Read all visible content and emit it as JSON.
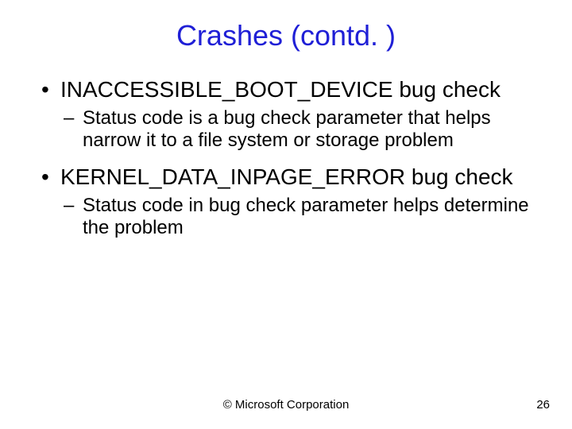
{
  "title": "Crashes (contd. )",
  "bullets": {
    "b1": "INACCESSIBLE_BOOT_DEVICE bug check",
    "b1a": "Status code is a bug check parameter that helps narrow it to a file system or storage problem",
    "b2": "KERNEL_DATA_INPAGE_ERROR bug check",
    "b2a": "Status code in bug check parameter helps determine the problem"
  },
  "footer": {
    "copyright": "© Microsoft Corporation",
    "page": "26"
  }
}
